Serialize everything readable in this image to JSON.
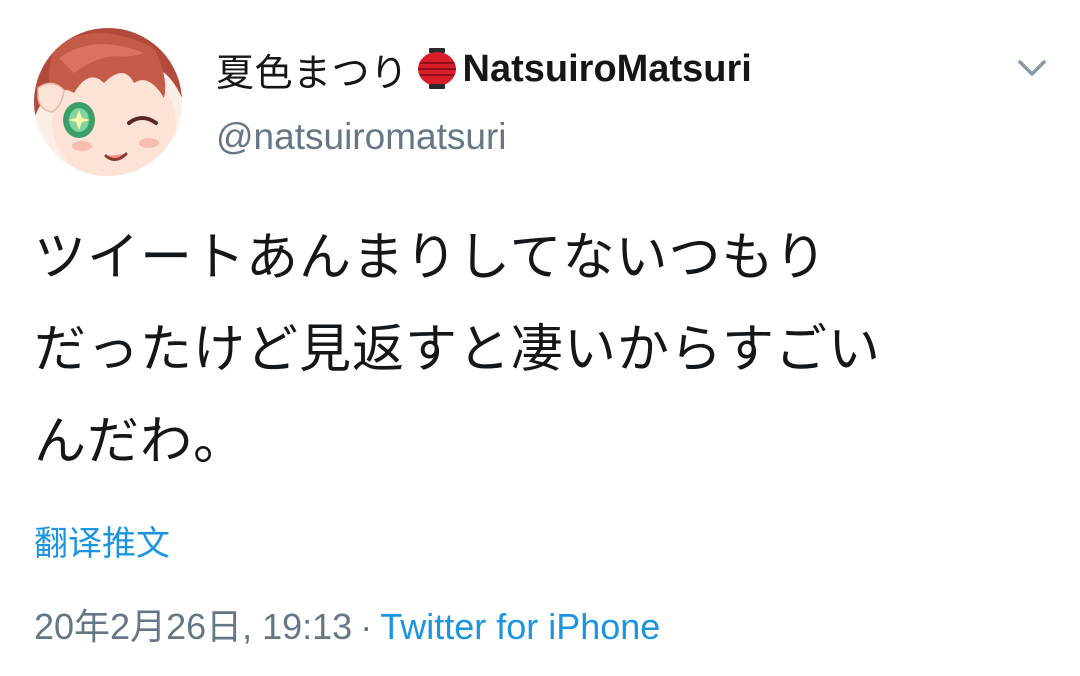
{
  "user": {
    "display_name": "夏色まつり",
    "display_name_en": "NatsuiroMatsuri",
    "handle": "@natsuiromatsuri",
    "lantern_icon": "red-paper-lantern-icon",
    "avatar_icon": "avatar-image"
  },
  "menu": {
    "icon": "chevron-down-icon"
  },
  "tweet": {
    "lines": [
      "ツイートあんまりしてないつもり",
      "だったけど見返すと凄いからすごい",
      "んだわ。"
    ]
  },
  "translate": {
    "label": "翻译推文"
  },
  "meta": {
    "timestamp": "20年2月26日, 19:13",
    "separator": "·",
    "source": "Twitter for iPhone"
  },
  "colors": {
    "text": "#14171a",
    "secondary": "#657786",
    "link": "#1b95e0",
    "lantern": "#d81e2a"
  }
}
